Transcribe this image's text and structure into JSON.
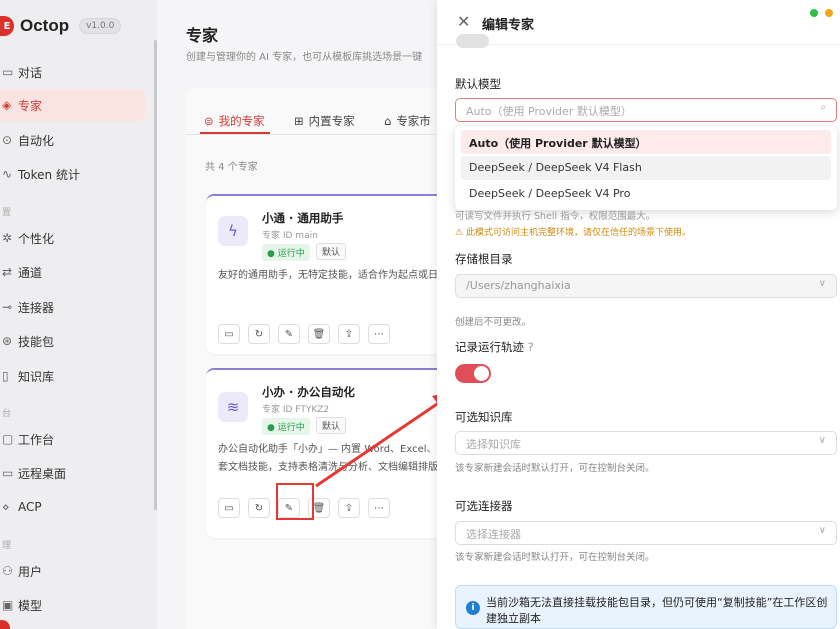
{
  "app": {
    "name": "Octop",
    "version": "v1.0.0"
  },
  "sidebar": {
    "items": [
      {
        "label": "对话",
        "icon": "chat-icon"
      },
      {
        "label": "专家",
        "icon": "expert-icon",
        "active": true
      },
      {
        "label": "自动化",
        "icon": "automation-icon"
      },
      {
        "label": "Token 统计",
        "icon": "chart-icon"
      },
      {
        "label": "个性化",
        "icon": "personalize-icon"
      },
      {
        "label": "通道",
        "icon": "channel-icon"
      },
      {
        "label": "连接器",
        "icon": "connector-icon"
      },
      {
        "label": "技能包",
        "icon": "skill-icon"
      },
      {
        "label": "知识库",
        "icon": "book-icon"
      },
      {
        "label": "工作台",
        "icon": "workbench-icon"
      },
      {
        "label": "远程桌面",
        "icon": "remote-icon"
      },
      {
        "label": "ACP",
        "icon": "acp-icon"
      },
      {
        "label": "用户",
        "icon": "user-icon"
      },
      {
        "label": "模型",
        "icon": "model-icon"
      }
    ]
  },
  "main": {
    "title": "专家",
    "subtitle": "创建与管理你的 AI 专家，也可从模板库挑选场景一键",
    "tabs": [
      {
        "label": "我的专家",
        "active": true
      },
      {
        "label": "内置专家"
      },
      {
        "label": "专家市"
      }
    ],
    "count": "共 4 个专家",
    "cards": [
      {
        "name": "小通 · 通用助手",
        "id": "专家 ID main",
        "status": "● 运行中",
        "default": "默认",
        "desc": "友好的通用助手，无特定技能，适合作为起点或日",
        "desc2": ""
      },
      {
        "name": "小办 · 办公自动化",
        "id": "专家 ID FTYKZ2",
        "status": "● 运行中",
        "default": "默认",
        "desc": "办公自动化助手「小办」— 内置 Word、Excel、P",
        "desc2": "套文档技能，支持表格清洗与分析、文档编辑排版"
      }
    ]
  },
  "drawer": {
    "title": "编辑专家",
    "model_label": "默认模型",
    "model_placeholder": "Auto（使用 Provider 默认模型）",
    "options": [
      "Auto（使用 Provider 默认模型）",
      "DeepSeek / DeepSeek V4 Flash",
      "DeepSeek / DeepSeek V4 Pro"
    ],
    "partial_hint": "可读写文件并执行 Shell 指令，权限范围最大。",
    "warning": "此模式可访问主机完整环境，请仅在信任的场景下使用。",
    "storage_label": "存储根目录",
    "storage_value": "/Users/zhanghaixia",
    "storage_hint": "创建后不可更改。",
    "trace_label": "记录运行轨迹",
    "kb_label": "可选知识库",
    "kb_placeholder": "选择知识库",
    "kb_hint": "该专家新建会话时默认打开，可在控制台关闭。",
    "conn_label": "可选连接器",
    "conn_placeholder": "选择连接器",
    "conn_hint": "该专家新建会话时默认打开，可在控制台关闭。",
    "info": "当前沙箱无法直接挂载技能包目录，但仍可使用“复制技能”在工作区创建独立副本"
  }
}
